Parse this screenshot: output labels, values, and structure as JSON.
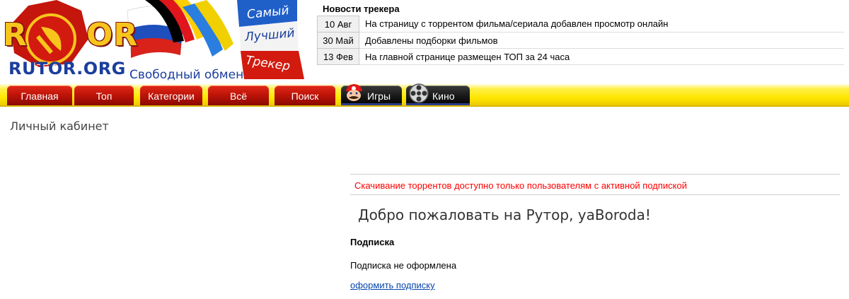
{
  "logo": {
    "letters_left": "R",
    "letters_right": "OR",
    "site_name": "RUTOR.ORG",
    "slogan": "Свободный обмен",
    "words": [
      "Самый",
      "Лучший",
      "Трекер"
    ]
  },
  "news": {
    "title": "Новости трекера",
    "items": [
      {
        "date": "10 Авг",
        "text": "На страницу с торрентом фильма/сериала добавлен просмотр онлайн"
      },
      {
        "date": "30 Май",
        "text": "Добавлены подборки фильмов"
      },
      {
        "date": "13 Фев",
        "text": "На главной странице размещен ТОП за 24 часа"
      }
    ]
  },
  "menu": {
    "tabs": [
      {
        "label": "Главная"
      },
      {
        "label": "Топ"
      },
      {
        "label": "Категории"
      },
      {
        "label": "Всё"
      },
      {
        "label": "Поиск"
      },
      {
        "label": "Игры",
        "icon": "mario-icon"
      },
      {
        "label": "Кино",
        "icon": "film-reel-icon"
      }
    ]
  },
  "page": {
    "heading": "Личный кабинет",
    "notice": "Скачивание торрентов доступно только пользователям с активной подпиской",
    "welcome": "Добро пожаловать на Рутор, yaBoroda!",
    "subscription_heading": "Подписка",
    "subscription_status": "Подписка не оформлена",
    "subscribe_link": "оформить подписку"
  },
  "colors": {
    "menu_red": "#c01408",
    "menu_yellow": "#ffe600",
    "notice_red": "#ff0000",
    "link_blue": "#0645ad",
    "logo_blue": "#1b3e9c"
  }
}
